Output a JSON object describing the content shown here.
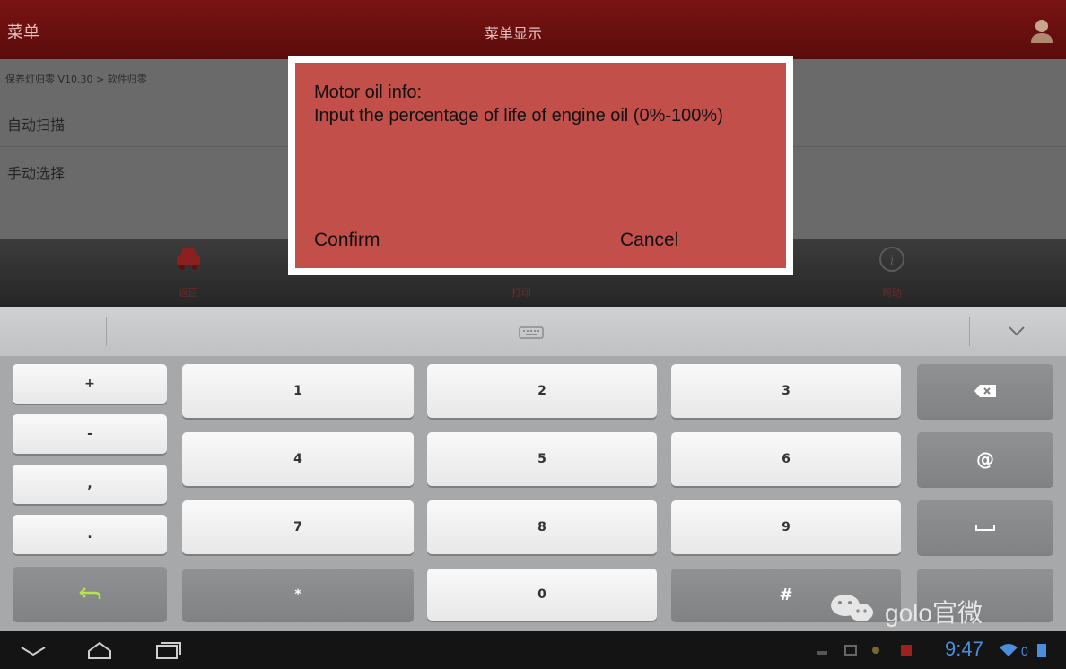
{
  "titlebar": {
    "menu_label": "菜单",
    "title": "菜单显示"
  },
  "content": {
    "breadcrumb": "保养灯归零 V10.30 > 软件归零",
    "menu_items": [
      {
        "label": "自动扫描"
      },
      {
        "label": "手动选择"
      }
    ]
  },
  "bottombar": {
    "items": [
      {
        "label": "返回"
      },
      {
        "label": "打印"
      },
      {
        "label": "帮助"
      }
    ]
  },
  "dialog": {
    "title": "Motor oil info:",
    "message": "Input the percentage of life of engine oil (0%-100%)",
    "confirm_label": "Confirm",
    "cancel_label": "Cancel"
  },
  "keyboard": {
    "left_keys": [
      "+",
      "-",
      ",",
      "."
    ],
    "rows": [
      [
        "1",
        "2",
        "3"
      ],
      [
        "4",
        "5",
        "6"
      ],
      [
        "7",
        "8",
        "9"
      ],
      [
        "*",
        "0",
        "#"
      ]
    ],
    "at_label": "@"
  },
  "statusbar": {
    "time": "9:47"
  },
  "watermark": {
    "text": "golo官微"
  },
  "colors": {
    "titlebar": "#6b1010",
    "dialog_bg": "#c24f4a",
    "keyboard_bg": "#a6a8aa",
    "clock": "#4a8edc"
  }
}
